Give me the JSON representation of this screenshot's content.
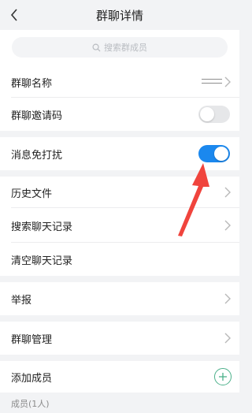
{
  "header": {
    "title": "群聊详情",
    "back_icon": "chevron-left-icon"
  },
  "search": {
    "placeholder": "搜索群成员",
    "icon": "search-icon"
  },
  "rows": {
    "group_name": {
      "label": "群聊名称"
    },
    "invite_code": {
      "label": "群聊邀请码",
      "toggle": false
    },
    "do_not_disturb": {
      "label": "消息免打扰",
      "toggle": true
    },
    "history_files": {
      "label": "历史文件"
    },
    "search_history": {
      "label": "搜索聊天记录"
    },
    "clear_history": {
      "label": "清空聊天记录"
    },
    "report": {
      "label": "举报"
    },
    "group_manage": {
      "label": "群聊管理"
    },
    "add_member": {
      "label": "添加成员"
    }
  },
  "members": {
    "label": "成员(1人)"
  },
  "colors": {
    "toggle_on": "#1b88ee",
    "toggle_off": "#e6e7e9",
    "add_accent": "#4bb08a",
    "annotation_arrow": "#f0443d",
    "background": "#f2f3f5"
  }
}
